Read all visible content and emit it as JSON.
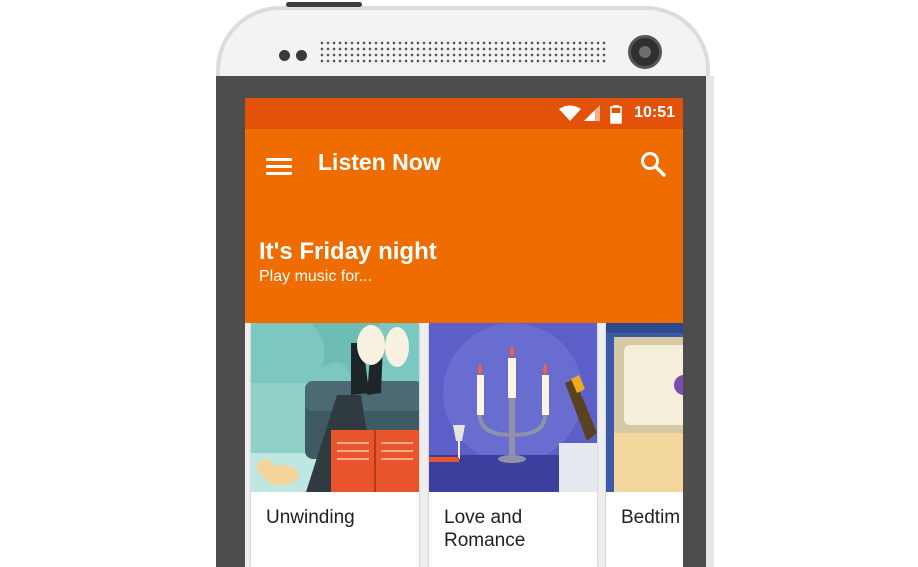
{
  "status_bar": {
    "time": "10:51"
  },
  "app_bar": {
    "title": "Listen Now"
  },
  "hero": {
    "headline": "It's Friday night",
    "subhead": "Play music for..."
  },
  "cards": [
    {
      "label": "Unwinding"
    },
    {
      "label": "Love and Romance"
    },
    {
      "label": "Bedtim"
    }
  ],
  "colors": {
    "status_bar": "#e25208",
    "app_bar": "#ef6c00",
    "phone_body": "#4d4d4d"
  },
  "icons": [
    "menu-icon",
    "search-icon",
    "wifi-icon",
    "signal-icon",
    "battery-icon"
  ]
}
